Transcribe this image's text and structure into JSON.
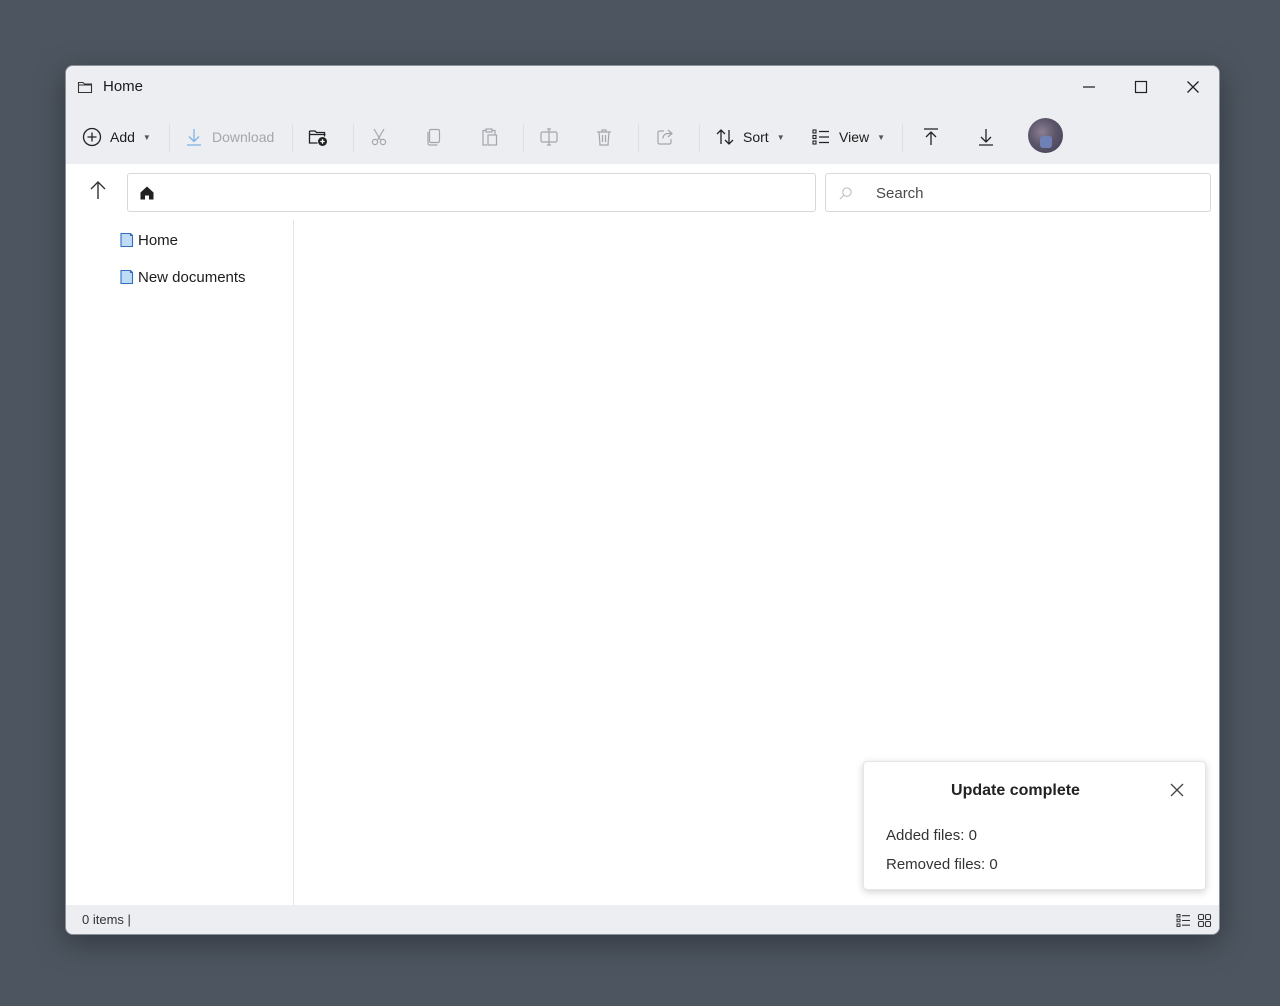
{
  "window": {
    "title": "Home",
    "controls": [
      "minimize",
      "maximize",
      "close"
    ]
  },
  "toolbar": {
    "add_label": "Add",
    "download_label": "Download",
    "sort_label": "Sort",
    "view_label": "View",
    "icons": [
      "add-circle-icon",
      "download-icon",
      "new-folder-icon",
      "cut-icon",
      "copy-icon",
      "paste-icon",
      "rename-icon",
      "delete-icon",
      "share-icon",
      "sort-icon",
      "view-list-icon",
      "upload-icon",
      "download-arrow-icon",
      "avatar"
    ]
  },
  "nav": {
    "address_icon": "home-icon",
    "search_placeholder": "Search"
  },
  "sidebar": {
    "items": [
      {
        "label": "Home",
        "icon": "document-icon"
      },
      {
        "label": "New documents",
        "icon": "document-icon"
      }
    ]
  },
  "status": {
    "items_text": "0 items |"
  },
  "toast": {
    "title": "Update complete",
    "added_label": "Added files:",
    "added_value": "0",
    "removed_label": "Removed files:",
    "removed_value": "0"
  },
  "colors": {
    "chrome_bg": "#eceef2",
    "doc_icon": "#4a90d9",
    "disabled": "#a3a6ab"
  }
}
